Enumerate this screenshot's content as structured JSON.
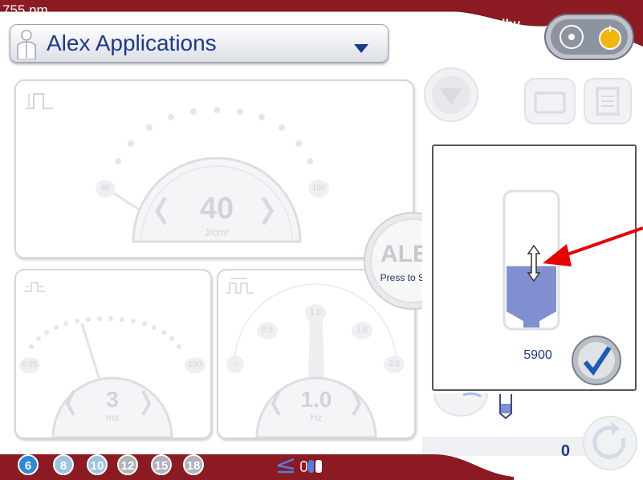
{
  "header": {
    "wavelength": "755 nm",
    "application_title": "Alex Applications",
    "status": "Standby"
  },
  "fluence": {
    "value": "40",
    "unit": "J/cm²",
    "min_label": "40",
    "max_label": "150"
  },
  "pulse_width": {
    "value": "3",
    "unit": "ms",
    "min_label": "0.25",
    "max_label": "100"
  },
  "repetition_rate": {
    "value": "1.0",
    "unit": "Hz",
    "ticks": [
      "–",
      "0.5",
      "1.0",
      "1.5",
      "2.0"
    ]
  },
  "laser_select": {
    "title": "ALEX",
    "subtitle": "Press to Select"
  },
  "selector": {
    "value": "5900",
    "level_fraction": 0.45
  },
  "pulse_counter": "0",
  "spot_sizes": [
    "6",
    "8",
    "10",
    "12",
    "15",
    "18"
  ],
  "icons": {
    "app_person": "doctor-person-icon",
    "dropdown": "triangle-down-icon",
    "standby": "standby-toggle-icon",
    "folder": "folder-icon",
    "document": "document-icon",
    "down": "down-arrow-circle-icon",
    "check": "checkmark-icon",
    "reset": "circular-arrow-icon",
    "handpiece": "handpiece-icon",
    "battery": "battery-icon"
  },
  "colors": {
    "brand_red": "#8b1a22",
    "title_blue": "#1b3a8c",
    "fill_blue": "#7f8fcf",
    "arrow_red": "#e60000"
  }
}
